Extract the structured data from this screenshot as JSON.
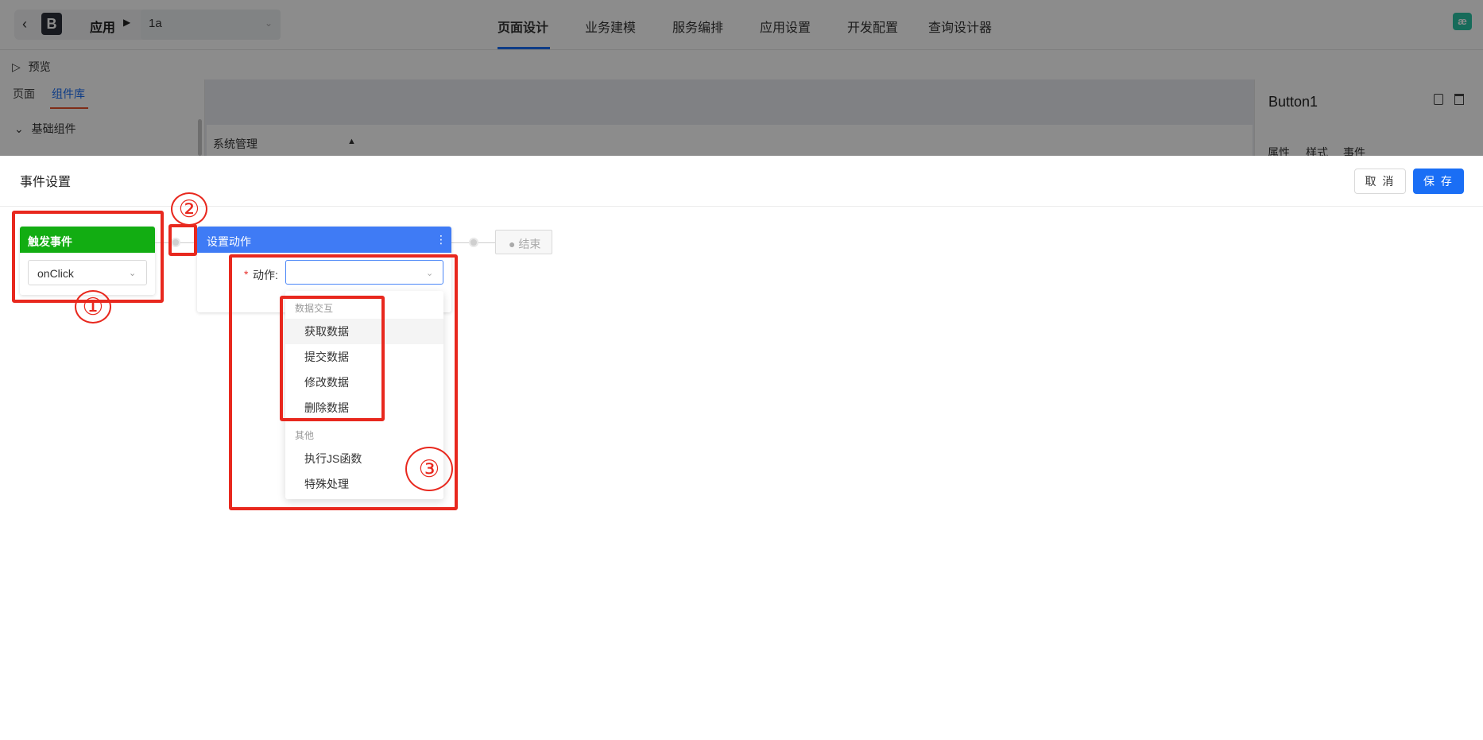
{
  "topbar": {
    "back_icon": "chevron-left-icon",
    "logo_letter": "B",
    "app_label": "应用",
    "app_select_value": "1a",
    "nav": [
      "页面设计",
      "业务建模",
      "服务编排",
      "应用设置",
      "开发配置",
      "查询设计器"
    ],
    "active_nav": "页面设计",
    "badge": "æ"
  },
  "left_panel": {
    "preview": "预览",
    "tabs": [
      "页面",
      "组件库"
    ],
    "active_tab": "组件库",
    "section": "基础组件"
  },
  "canvas": {
    "row_label": "系统管理"
  },
  "right_panel": {
    "title": "Button1",
    "tabs": [
      "属性",
      "样式",
      "事件"
    ]
  },
  "modal": {
    "title": "事件设置",
    "cancel_label": "取 消",
    "save_label": "保 存",
    "trigger": {
      "title": "触发事件",
      "value": "onClick"
    },
    "action": {
      "title": "设置动作",
      "label": "动作:",
      "required_mark": "*",
      "more_icon": "⋮"
    },
    "end_label": "● 结束",
    "dropdown": {
      "groups": [
        {
          "label": "数据交互",
          "items": [
            "获取数据",
            "提交数据",
            "修改数据",
            "删除数据"
          ]
        },
        {
          "label": "其他",
          "items": [
            "执行JS函数",
            "特殊处理"
          ]
        }
      ],
      "hovered_item": "获取数据"
    }
  },
  "annotations": {
    "markers": [
      "①",
      "②",
      "③"
    ],
    "color": "#e8281e"
  },
  "colors": {
    "primary": "#1a6ef5",
    "trigger_green": "#12ad12",
    "action_blue": "#3f7bf5"
  }
}
